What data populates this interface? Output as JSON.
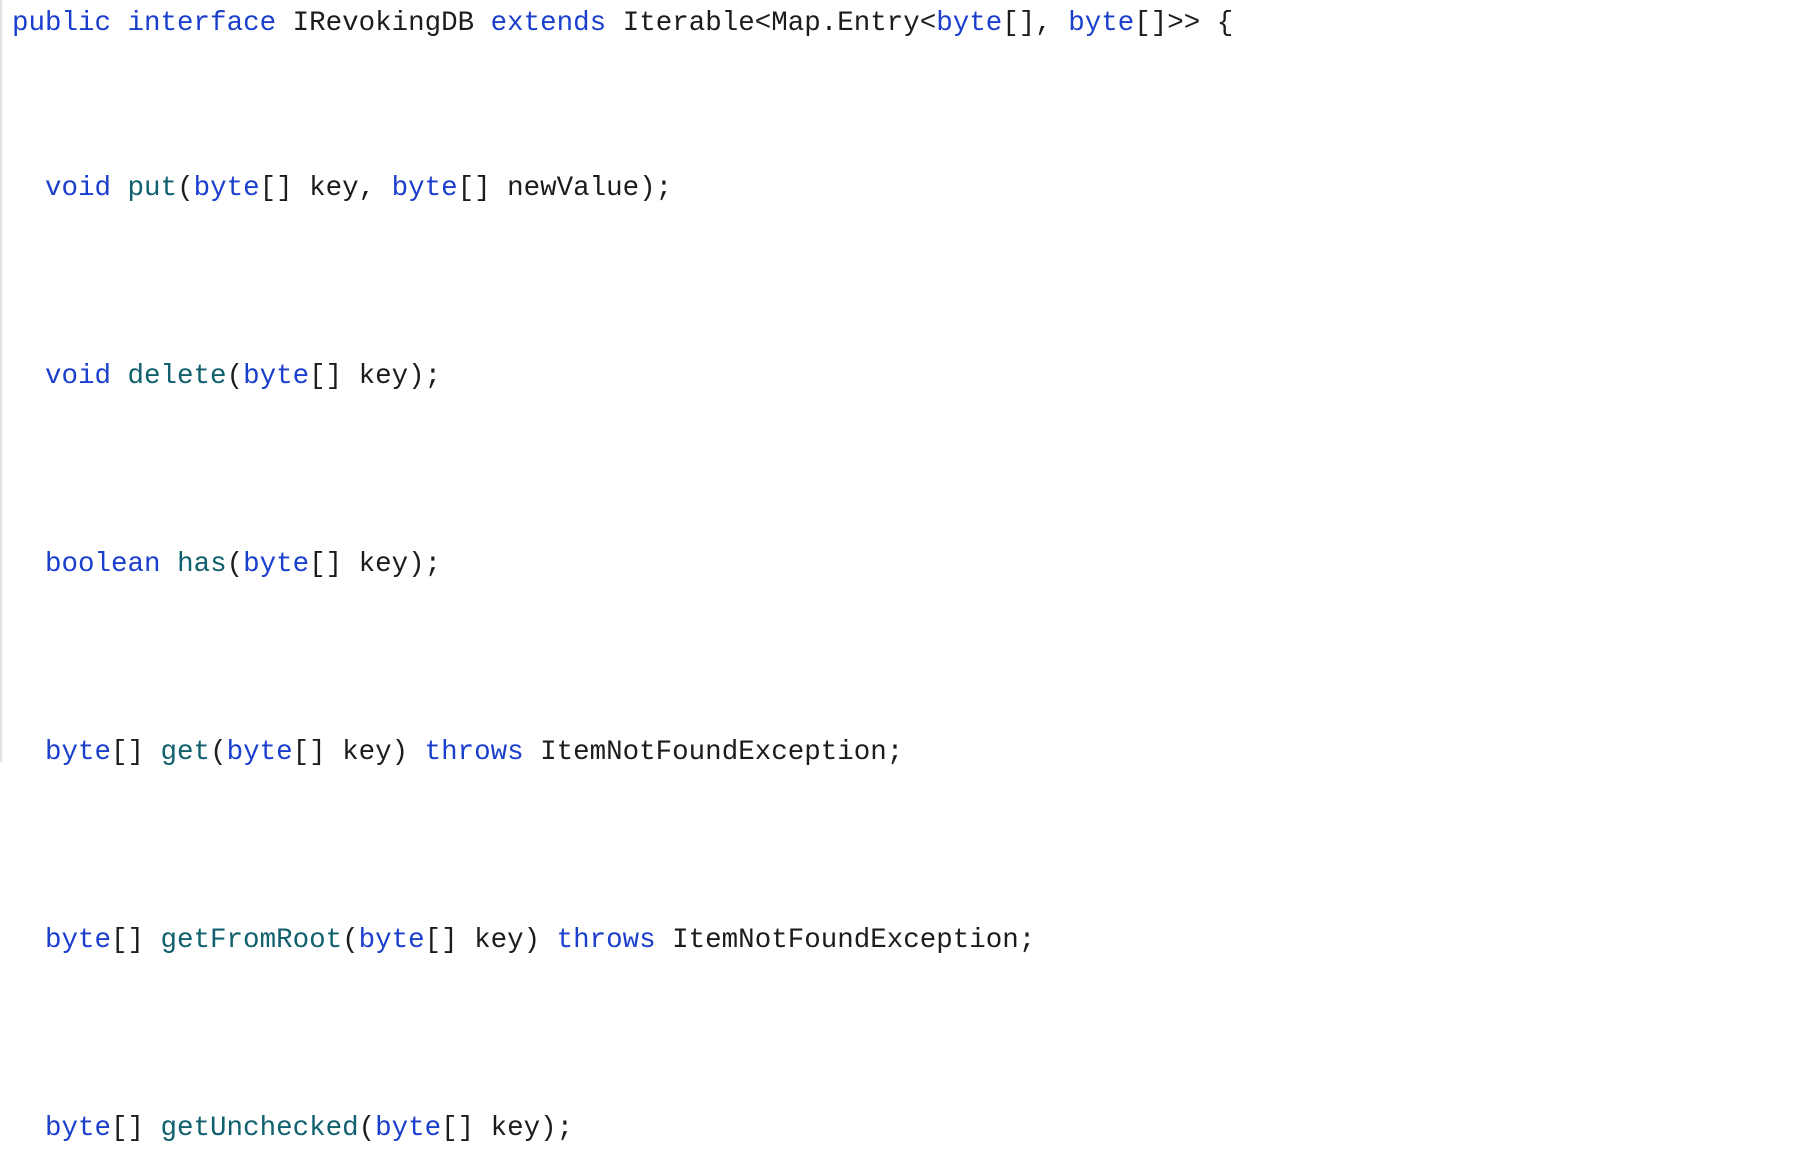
{
  "code_block": {
    "language": "java",
    "background_color": "#ffffff",
    "border_color": "#e3e3e3",
    "colors": {
      "keyword": "#1a3fcd",
      "function": "#10606e",
      "plain": "#1c1c1c"
    },
    "full_text": "public interface IRevokingDB extends Iterable<Map.Entry<byte[], byte[]>> {\n\n  void put(byte[] key, byte[] newValue);\n\n  void delete(byte[] key);\n\n  boolean has(byte[] key);\n\n  byte[] get(byte[] key) throws ItemNotFoundException;\n\n  byte[] getFromRoot(byte[] key) throws ItemNotFoundException;\n\n  byte[] getUnchecked(byte[] key);",
    "lines": [
      {
        "id": "line-declaration",
        "indent": "",
        "tokens": [
          {
            "t": "public",
            "k": "kw"
          },
          {
            "t": " ",
            "k": "pl"
          },
          {
            "t": "interface",
            "k": "kw"
          },
          {
            "t": " ",
            "k": "pl"
          },
          {
            "t": "IRevokingDB",
            "k": "pl"
          },
          {
            "t": " ",
            "k": "pl"
          },
          {
            "t": "extends",
            "k": "kw"
          },
          {
            "t": " ",
            "k": "pl"
          },
          {
            "t": "Iterable<Map.Entry<",
            "k": "pl"
          },
          {
            "t": "byte",
            "k": "kw"
          },
          {
            "t": "[], ",
            "k": "pl"
          },
          {
            "t": "byte",
            "k": "kw"
          },
          {
            "t": "[]>> {",
            "k": "pl"
          }
        ]
      },
      {
        "id": "line-blank-1",
        "indent": "",
        "tokens": [
          {
            "t": "",
            "k": "pl"
          }
        ]
      },
      {
        "id": "line-method-put",
        "indent": "  ",
        "tokens": [
          {
            "t": "void",
            "k": "kw"
          },
          {
            "t": " ",
            "k": "pl"
          },
          {
            "t": "put",
            "k": "fn"
          },
          {
            "t": "(",
            "k": "pl"
          },
          {
            "t": "byte",
            "k": "kw"
          },
          {
            "t": "[] key, ",
            "k": "pl"
          },
          {
            "t": "byte",
            "k": "kw"
          },
          {
            "t": "[] newValue);",
            "k": "pl"
          }
        ]
      },
      {
        "id": "line-blank-2",
        "indent": "",
        "tokens": [
          {
            "t": "",
            "k": "pl"
          }
        ]
      },
      {
        "id": "line-method-delete",
        "indent": "  ",
        "tokens": [
          {
            "t": "void",
            "k": "kw"
          },
          {
            "t": " ",
            "k": "pl"
          },
          {
            "t": "delete",
            "k": "fn"
          },
          {
            "t": "(",
            "k": "pl"
          },
          {
            "t": "byte",
            "k": "kw"
          },
          {
            "t": "[] key);",
            "k": "pl"
          }
        ]
      },
      {
        "id": "line-blank-3",
        "indent": "",
        "tokens": [
          {
            "t": "",
            "k": "pl"
          }
        ]
      },
      {
        "id": "line-method-has",
        "indent": "  ",
        "tokens": [
          {
            "t": "boolean",
            "k": "kw"
          },
          {
            "t": " ",
            "k": "pl"
          },
          {
            "t": "has",
            "k": "fn"
          },
          {
            "t": "(",
            "k": "pl"
          },
          {
            "t": "byte",
            "k": "kw"
          },
          {
            "t": "[] key);",
            "k": "pl"
          }
        ]
      },
      {
        "id": "line-blank-4",
        "indent": "",
        "tokens": [
          {
            "t": "",
            "k": "pl"
          }
        ]
      },
      {
        "id": "line-method-get",
        "indent": "  ",
        "tokens": [
          {
            "t": "byte",
            "k": "kw"
          },
          {
            "t": "[] ",
            "k": "pl"
          },
          {
            "t": "get",
            "k": "fn"
          },
          {
            "t": "(",
            "k": "pl"
          },
          {
            "t": "byte",
            "k": "kw"
          },
          {
            "t": "[] key) ",
            "k": "pl"
          },
          {
            "t": "throws",
            "k": "kw"
          },
          {
            "t": " ItemNotFoundException;",
            "k": "pl"
          }
        ]
      },
      {
        "id": "line-blank-5",
        "indent": "",
        "tokens": [
          {
            "t": "",
            "k": "pl"
          }
        ]
      },
      {
        "id": "line-method-getfromroot",
        "indent": "  ",
        "tokens": [
          {
            "t": "byte",
            "k": "kw"
          },
          {
            "t": "[] ",
            "k": "pl"
          },
          {
            "t": "getFromRoot",
            "k": "fn"
          },
          {
            "t": "(",
            "k": "pl"
          },
          {
            "t": "byte",
            "k": "kw"
          },
          {
            "t": "[] key) ",
            "k": "pl"
          },
          {
            "t": "throws",
            "k": "kw"
          },
          {
            "t": " ItemNotFoundException;",
            "k": "pl"
          }
        ]
      },
      {
        "id": "line-blank-6",
        "indent": "",
        "tokens": [
          {
            "t": "",
            "k": "pl"
          }
        ]
      },
      {
        "id": "line-method-getunchecked",
        "indent": "  ",
        "tokens": [
          {
            "t": "byte",
            "k": "kw"
          },
          {
            "t": "[] ",
            "k": "pl"
          },
          {
            "t": "getUnchecked",
            "k": "fn"
          },
          {
            "t": "(",
            "k": "pl"
          },
          {
            "t": "byte",
            "k": "kw"
          },
          {
            "t": "[] key);",
            "k": "pl"
          }
        ]
      }
    ]
  }
}
